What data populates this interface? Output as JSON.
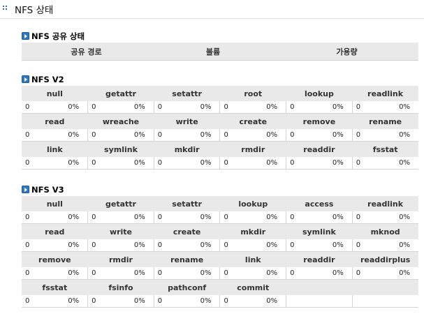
{
  "page": {
    "title": "NFS 상태"
  },
  "share": {
    "title": "NFS 공유 상태",
    "columns": [
      "공유 경로",
      "볼륨",
      "가용량"
    ]
  },
  "v2": {
    "title": "NFS V2",
    "rows": [
      {
        "names": [
          "null",
          "getattr",
          "setattr",
          "root",
          "lookup",
          "readlink"
        ],
        "values": [
          [
            "0",
            "0%"
          ],
          [
            "0",
            "0%"
          ],
          [
            "0",
            "0%"
          ],
          [
            "0",
            "0%"
          ],
          [
            "0",
            "0%"
          ],
          [
            "0",
            "0%"
          ]
        ]
      },
      {
        "names": [
          "read",
          "wreache",
          "write",
          "create",
          "remove",
          "rename"
        ],
        "values": [
          [
            "0",
            "0%"
          ],
          [
            "0",
            "0%"
          ],
          [
            "0",
            "0%"
          ],
          [
            "0",
            "0%"
          ],
          [
            "0",
            "0%"
          ],
          [
            "0",
            "0%"
          ]
        ]
      },
      {
        "names": [
          "link",
          "symlink",
          "mkdir",
          "rmdir",
          "readdir",
          "fsstat"
        ],
        "values": [
          [
            "0",
            "0%"
          ],
          [
            "0",
            "0%"
          ],
          [
            "0",
            "0%"
          ],
          [
            "0",
            "0%"
          ],
          [
            "0",
            "0%"
          ],
          [
            "0",
            "0%"
          ]
        ]
      }
    ]
  },
  "v3": {
    "title": "NFS V3",
    "rows": [
      {
        "names": [
          "null",
          "getattr",
          "setattr",
          "lookup",
          "access",
          "readlink"
        ],
        "values": [
          [
            "0",
            "0%"
          ],
          [
            "0",
            "0%"
          ],
          [
            "0",
            "0%"
          ],
          [
            "0",
            "0%"
          ],
          [
            "0",
            "0%"
          ],
          [
            "0",
            "0%"
          ]
        ]
      },
      {
        "names": [
          "read",
          "write",
          "create",
          "mkdir",
          "symlink",
          "mknod"
        ],
        "values": [
          [
            "0",
            "0%"
          ],
          [
            "0",
            "0%"
          ],
          [
            "0",
            "0%"
          ],
          [
            "0",
            "0%"
          ],
          [
            "0",
            "0%"
          ],
          [
            "0",
            "0%"
          ]
        ]
      },
      {
        "names": [
          "remove",
          "rmdir",
          "rename",
          "link",
          "readdir",
          "readdirplus"
        ],
        "values": [
          [
            "0",
            "0%"
          ],
          [
            "0",
            "0%"
          ],
          [
            "0",
            "0%"
          ],
          [
            "0",
            "0%"
          ],
          [
            "0",
            "0%"
          ],
          [
            "0",
            "0%"
          ]
        ]
      },
      {
        "names": [
          "fsstat",
          "fsinfo",
          "pathconf",
          "commit",
          "",
          ""
        ],
        "values": [
          [
            "0",
            "0%"
          ],
          [
            "0",
            "0%"
          ],
          [
            "0",
            "0%"
          ],
          [
            "0",
            "0%"
          ],
          [
            "",
            ""
          ],
          [
            "",
            ""
          ]
        ]
      }
    ]
  }
}
